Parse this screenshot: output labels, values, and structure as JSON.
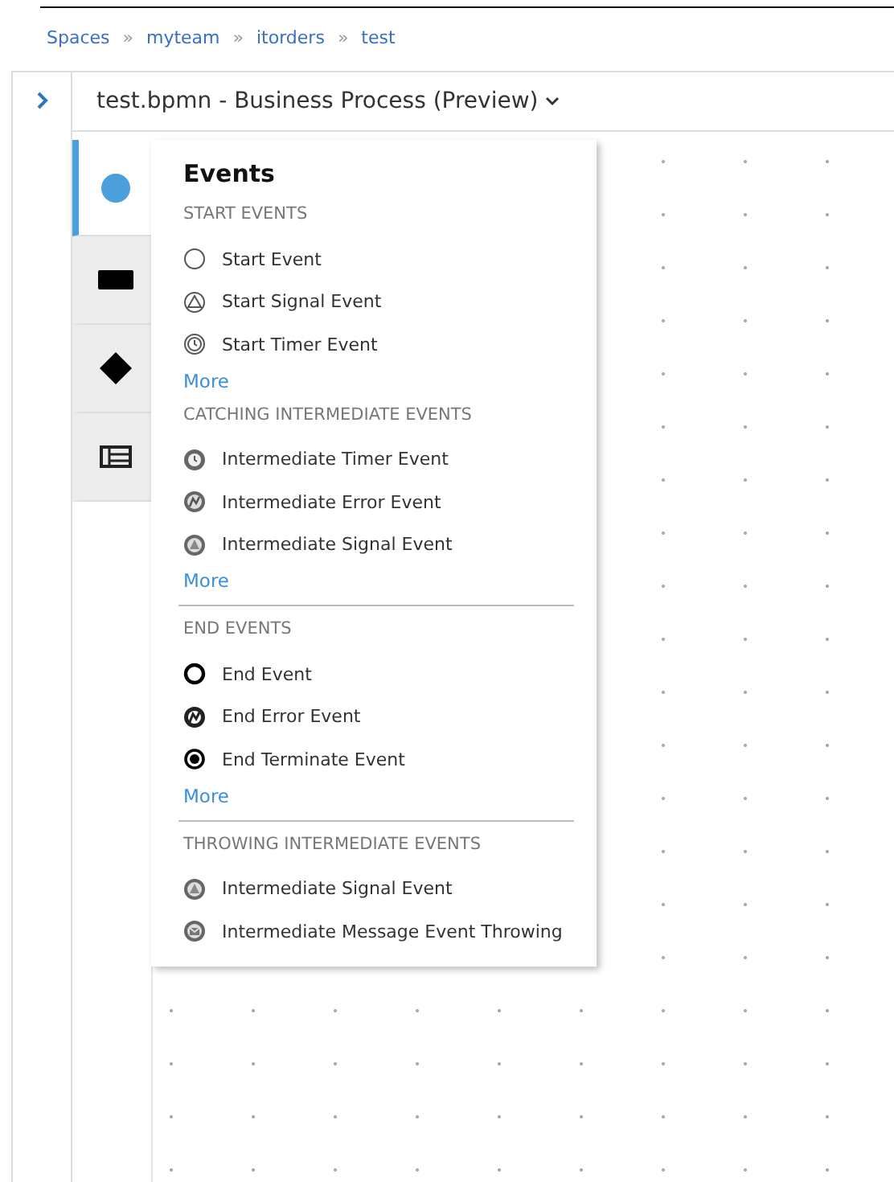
{
  "breadcrumb": [
    "Spaces",
    "myteam",
    "itorders",
    "test"
  ],
  "breadcrumb_separator": "»",
  "editor": {
    "title": "test.bpmn - Business Process (Preview)"
  },
  "palette": [
    {
      "kind": "events",
      "selected": true
    },
    {
      "kind": "activity",
      "selected": false
    },
    {
      "kind": "gateway",
      "selected": false
    },
    {
      "kind": "lane",
      "selected": false
    }
  ],
  "panel": {
    "title": "Events",
    "sections": [
      {
        "heading": "START EVENTS",
        "separated": false,
        "more": "More",
        "items": [
          {
            "kind": "start",
            "label": "Start Event"
          },
          {
            "kind": "start-signal",
            "label": "Start Signal Event"
          },
          {
            "kind": "start-timer",
            "label": "Start Timer Event"
          }
        ]
      },
      {
        "heading": "CATCHING INTERMEDIATE EVENTS",
        "separated": false,
        "more": "More",
        "items": [
          {
            "kind": "int-timer",
            "label": "Intermediate Timer Event"
          },
          {
            "kind": "int-error",
            "label": "Intermediate Error Event"
          },
          {
            "kind": "int-signal",
            "label": "Intermediate Signal Event"
          }
        ]
      },
      {
        "heading": "END EVENTS",
        "separated": true,
        "more": "More",
        "items": [
          {
            "kind": "end",
            "label": "End Event"
          },
          {
            "kind": "end-error",
            "label": "End Error Event"
          },
          {
            "kind": "end-terminate",
            "label": "End Terminate Event"
          }
        ]
      },
      {
        "heading": "THROWING INTERMEDIATE EVENTS",
        "separated": true,
        "items": [
          {
            "kind": "int-signal",
            "label": "Intermediate Signal Event"
          },
          {
            "kind": "int-message",
            "label": "Intermediate Message Event Throwing"
          }
        ]
      }
    ]
  }
}
